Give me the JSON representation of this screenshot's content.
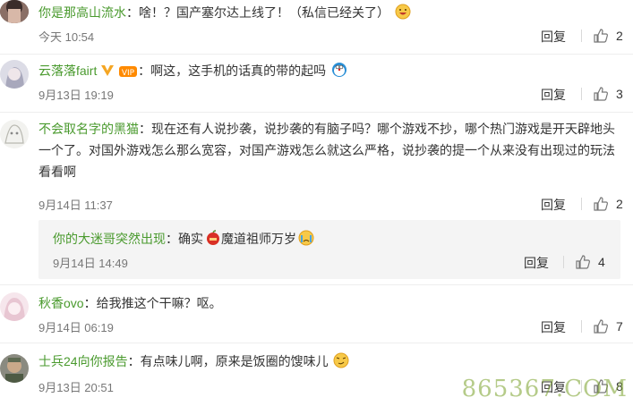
{
  "comments": [
    {
      "user": "你是那高山流水",
      "text": "：啥！？国产塞尔达上线了！（私信已经关了）",
      "time": "今天 10:54",
      "reply": "回复",
      "likes": "2",
      "emoji": "grin-emoji"
    },
    {
      "user": "云落落fairt",
      "text": "：啊这，这手机的话真的带的起吗",
      "time": "9月13日 19:19",
      "reply": "回复",
      "likes": "3",
      "emoji": "doraemon-emoji"
    },
    {
      "user": "不会取名字的黑猫",
      "text": "：现在还有人说抄袭，说抄袭的有脑子吗？哪个游戏不抄，哪个热门游戏是开天辟地头一个了。对国外游戏怎么那么宽容，对国产游戏怎么就这么严格，说抄袭的提一个从来没有出现过的玩法看看啊",
      "time": "9月14日 11:37",
      "reply": "回复",
      "likes": "2",
      "sub": {
        "user": "你的大迷哥突然出现",
        "text_a": "：确实",
        "text_b": "魔道祖师万岁",
        "time": "9月14日 14:49",
        "reply": "回复",
        "likes": "4"
      }
    },
    {
      "user": "秋香ovo",
      "text": "：给我推这个干嘛？呕。",
      "time": "9月14日 06:19",
      "reply": "回复",
      "likes": "7"
    },
    {
      "user": "士兵24向你报告",
      "text": "：有点味儿啊，原来是饭圈的馊味儿",
      "time": "9月13日 20:51",
      "reply": "回复",
      "likes": "8",
      "emoji": "smirk-emoji"
    }
  ],
  "watermark": "865367.COM",
  "colors": {
    "username": "#4a9a2e",
    "meta": "#777777",
    "subreply_bg": "#f4f4f4"
  }
}
